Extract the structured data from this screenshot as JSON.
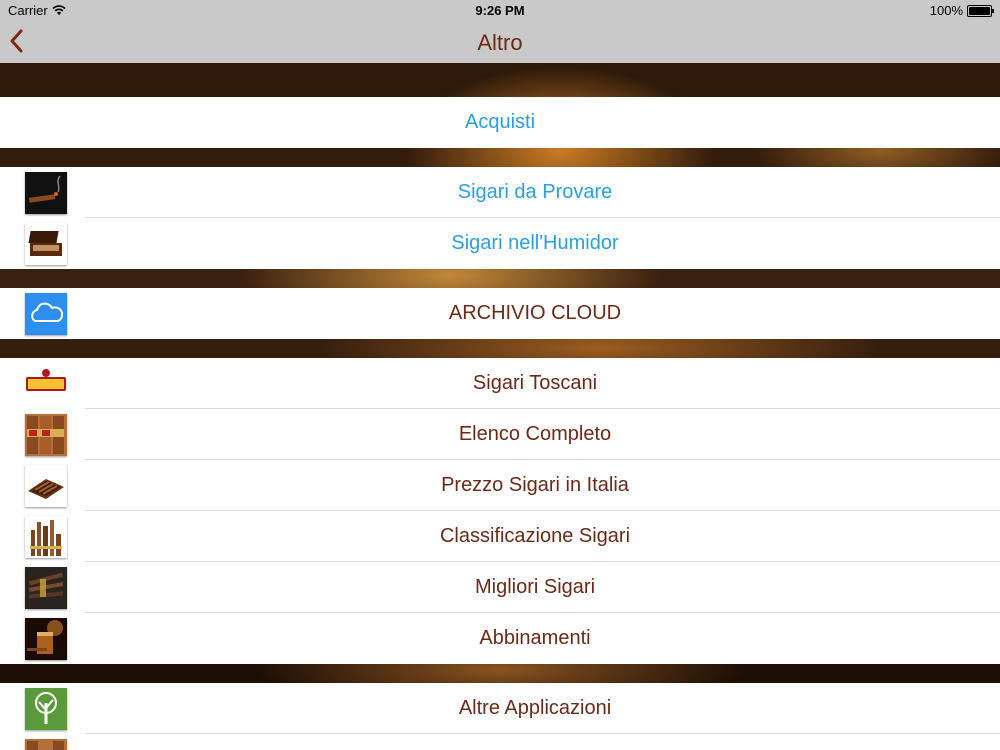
{
  "status_bar": {
    "carrier": "Carrier",
    "time": "9:26 PM",
    "battery": "100%"
  },
  "nav": {
    "title": "Altro",
    "back_icon": "chevron-left-icon"
  },
  "colors": {
    "accent_blue": "#2a9fe0",
    "label_brown": "#6b2a18",
    "bar_gray": "#c9c9c9"
  },
  "sections": {
    "purchases": {
      "label": "Acquisti"
    },
    "personal": [
      {
        "label": "Sigari da Provare",
        "icon": "cigar-smoke-icon"
      },
      {
        "label": "Sigari nell'Humidor",
        "icon": "humidor-icon"
      }
    ],
    "cloud": {
      "label": "ARCHIVIO CLOUD",
      "icon": "cloud-icon"
    },
    "catalog": [
      {
        "label": "Sigari Toscani",
        "icon": "toscano-logo-icon"
      },
      {
        "label": "Elenco Completo",
        "icon": "cigar-bands-icon"
      },
      {
        "label": "Prezzo Sigari in Italia",
        "icon": "cigar-box-icon"
      },
      {
        "label": "Classificazione Sigari",
        "icon": "cigar-sizes-icon"
      },
      {
        "label": "Migliori Sigari",
        "icon": "cigar-bundle-icon"
      },
      {
        "label": "Abbinamenti",
        "icon": "whisky-glass-icon"
      }
    ],
    "other": [
      {
        "label": "Altre Applicazioni",
        "icon": "tree-icon"
      }
    ]
  }
}
